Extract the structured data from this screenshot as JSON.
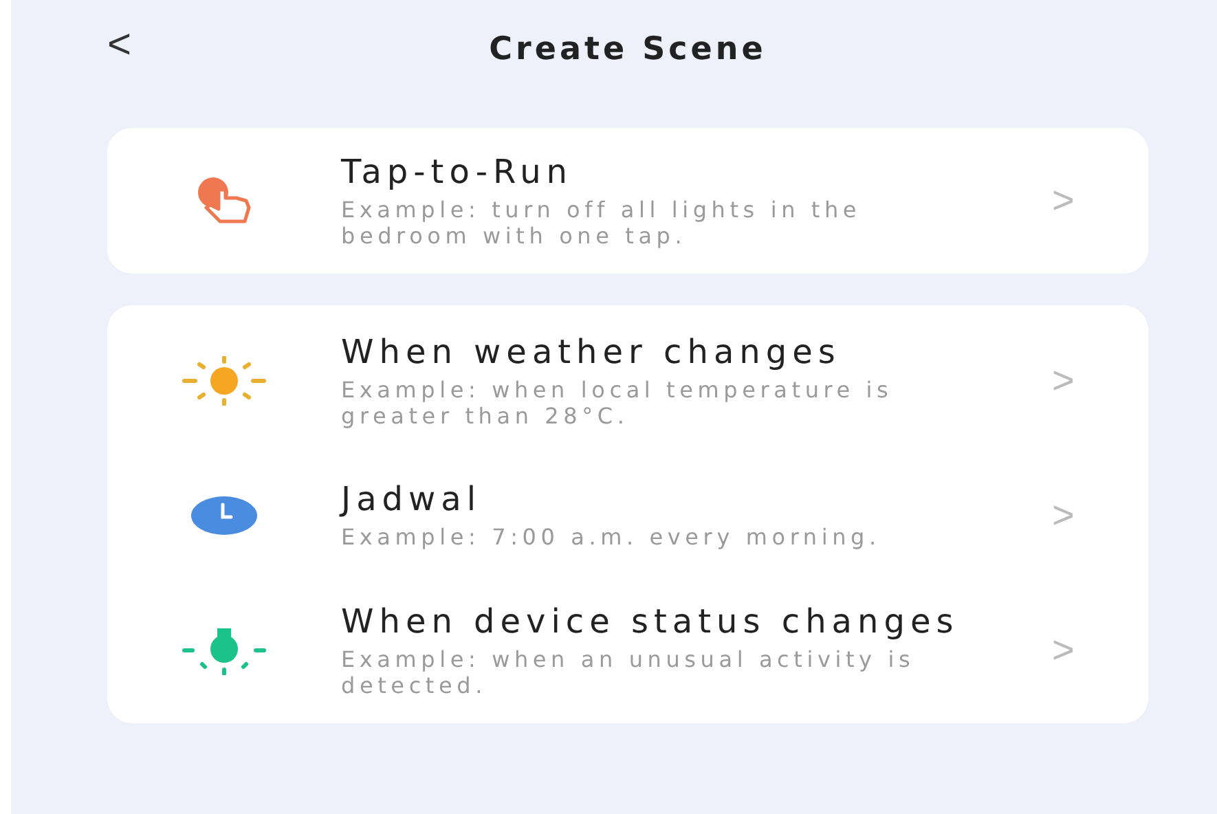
{
  "header": {
    "back": "<",
    "title": "Create Scene"
  },
  "groups": [
    {
      "items": [
        {
          "kind": "tap",
          "title": "Tap-to-Run",
          "description": "Example: turn off all lights in the bedroom with one tap.",
          "chevron": ">"
        }
      ]
    },
    {
      "items": [
        {
          "kind": "sun",
          "title": "When weather changes",
          "description": "Example: when local temperature is greater than 28°C.",
          "chevron": ">"
        },
        {
          "kind": "clock",
          "title": "Jadwal",
          "description": "Example: 7:00 a.m. every morning.",
          "chevron": ">"
        },
        {
          "kind": "bulb",
          "title": "When device status changes",
          "description": "Example: when an unusual activity is detected.",
          "chevron": ">"
        }
      ]
    }
  ]
}
